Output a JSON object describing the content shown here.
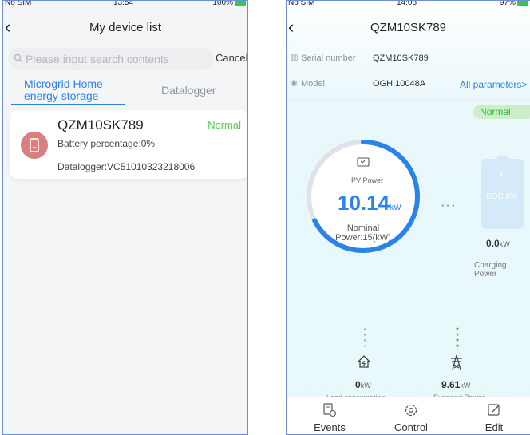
{
  "left": {
    "status": {
      "carrier": "No SIM",
      "time": "13:54",
      "battery": "100%"
    },
    "title": "My device list",
    "search": {
      "placeholder": "Please input search contents",
      "cancel": "Cancel"
    },
    "tabs": [
      {
        "label_line1": "Microgrid Home",
        "label_line2": "energy storage"
      },
      {
        "label": "Datalogger"
      }
    ],
    "device": {
      "name": "QZM10SK789",
      "status": "Normal",
      "battery": "Battery percentage:0%",
      "datalogger": "Datalogger:VC51010323218006"
    }
  },
  "right": {
    "status": {
      "carrier": "No SIM",
      "time": "14:08",
      "battery": "97%"
    },
    "title": "QZM10SK789",
    "serial_label": "Serial number",
    "serial_value": "QZM10SK789",
    "model_label": "Model",
    "model_value": "OGHI10048A",
    "all_params": "All parameters>",
    "status_badge": "Normal",
    "pv": {
      "label": "PV Power",
      "value": "10.14",
      "unit": "kW",
      "nominal_line1": "Nominal",
      "nominal_line2": "Power:15(kW)",
      "ratio": 0.676
    },
    "battery": {
      "soc": "SOC 0%",
      "value": "0.0",
      "unit": "kW",
      "label": "Charging Power"
    },
    "load": {
      "value": "0",
      "unit": "kW",
      "label": "Load consumption"
    },
    "export": {
      "value": "9.61",
      "unit": "kW",
      "label": "Exported Power"
    },
    "bottom": {
      "events": "Events",
      "control": "Control",
      "edit": "Edit"
    },
    "colors": {
      "accent": "#2a83e6",
      "ok": "#36b539",
      "export_flow": "#3ec43e"
    }
  }
}
